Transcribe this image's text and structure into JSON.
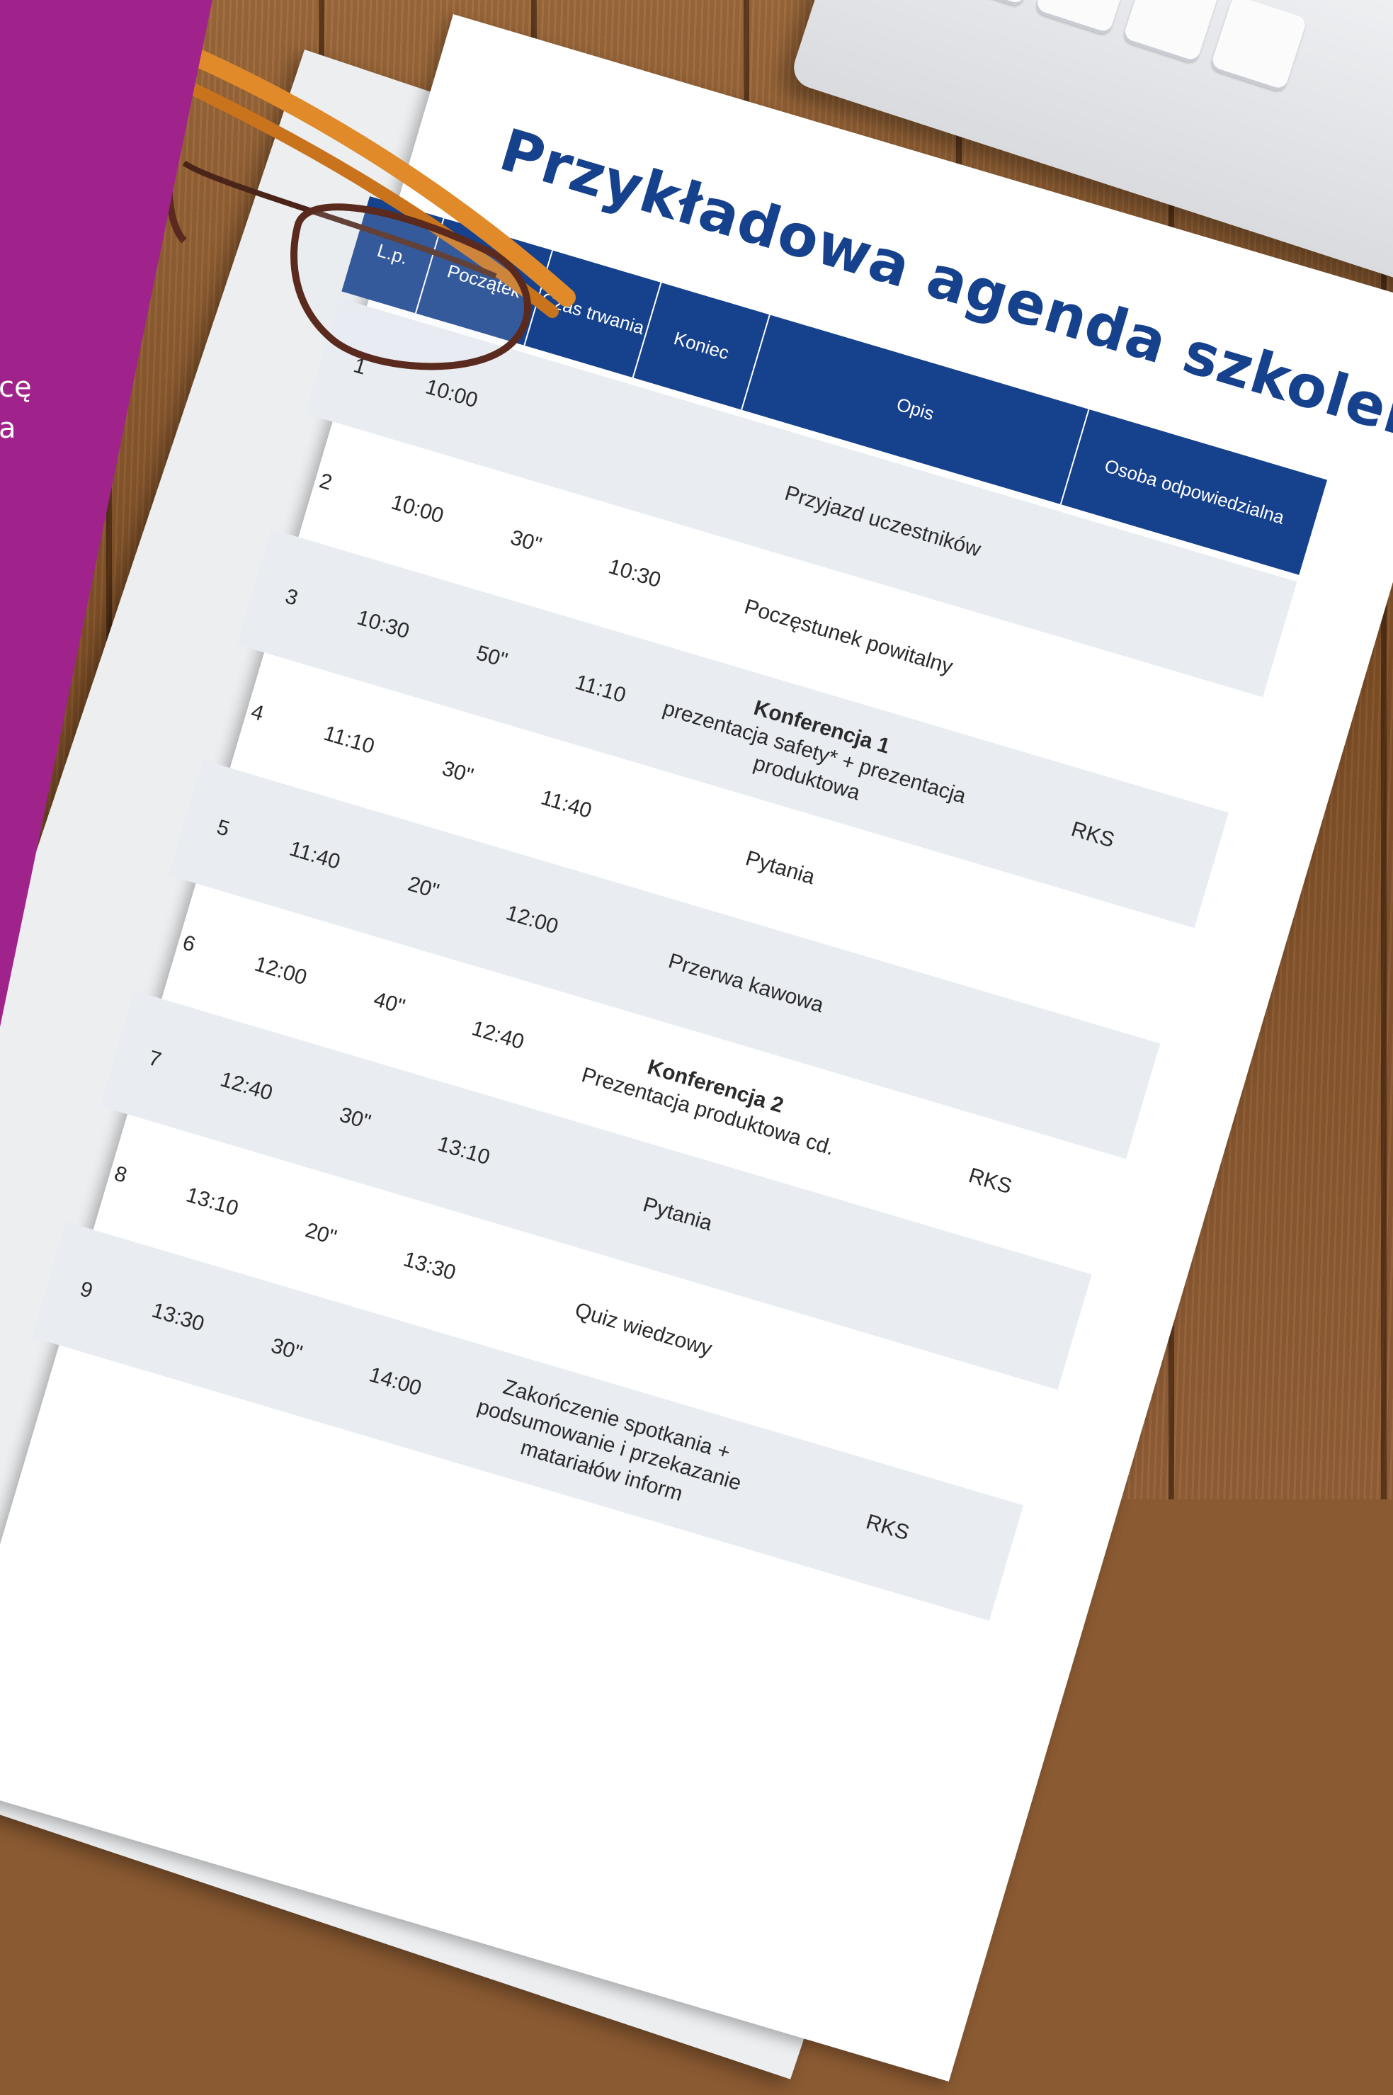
{
  "document": {
    "title": "Przykładowa agenda szkolenia",
    "columns": [
      "L.p.",
      "Początek",
      "Czas trwania",
      "Koniec",
      "Opis",
      "Osoba odpowiedzialna"
    ],
    "rows": [
      {
        "lp": "1",
        "start": "10:00",
        "duration": "",
        "end": "",
        "desc_bold": "",
        "desc": "Przyjazd uczestników",
        "person": ""
      },
      {
        "lp": "2",
        "start": "10:00",
        "duration": "30\"",
        "end": "10:30",
        "desc_bold": "",
        "desc": "Poczęstunek powitalny",
        "person": ""
      },
      {
        "lp": "3",
        "start": "10:30",
        "duration": "50\"",
        "end": "11:10",
        "desc_bold": "Konferencja 1",
        "desc": "prezentacja safety* + prezentacja produktowa",
        "person": "RKS"
      },
      {
        "lp": "4",
        "start": "11:10",
        "duration": "30\"",
        "end": "11:40",
        "desc_bold": "",
        "desc": "Pytania",
        "person": ""
      },
      {
        "lp": "5",
        "start": "11:40",
        "duration": "20\"",
        "end": "12:00",
        "desc_bold": "",
        "desc": "Przerwa kawowa",
        "person": ""
      },
      {
        "lp": "6",
        "start": "12:00",
        "duration": "40\"",
        "end": "12:40",
        "desc_bold": "Konferencja 2",
        "desc": "Prezentacja produktowa cd.",
        "person": "RKS"
      },
      {
        "lp": "7",
        "start": "12:40",
        "duration": "30\"",
        "end": "13:10",
        "desc_bold": "",
        "desc": "Pytania",
        "person": ""
      },
      {
        "lp": "8",
        "start": "13:10",
        "duration": "20\"",
        "end": "13:30",
        "desc_bold": "",
        "desc": "Quiz wiedzowy",
        "person": ""
      },
      {
        "lp": "9",
        "start": "13:30",
        "duration": "30\"",
        "end": "14:00",
        "desc_bold": "",
        "desc": "Zakończenie spotkania + podsumowanie i przekazanie matariałów inform",
        "person": "RKS"
      }
    ]
  },
  "sidebar": {
    "text_line1": "cę",
    "text_line2": "a"
  },
  "colors": {
    "purple_band": "#a0238c",
    "header_blue": "#16418c",
    "row_shade": "#e9edf2"
  }
}
